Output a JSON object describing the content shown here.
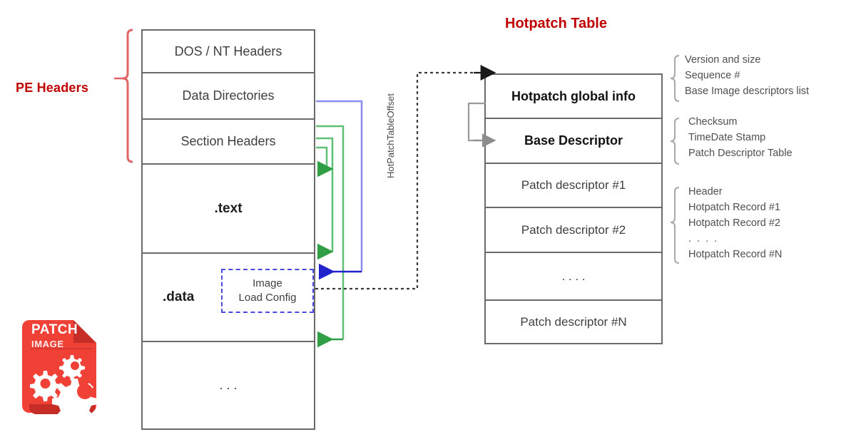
{
  "diagram": {
    "title_hotpatch_table": "Hotpatch Table",
    "pe_headers_label": "PE Headers",
    "offset_label": "HotPatchTableOffset",
    "colors": {
      "accent_red": "#c00000",
      "box_border": "#6a6a6a",
      "green_arrow": "#2f9e44",
      "blue_arrow": "#2222cc",
      "dashed_blue": "#4a4ae0",
      "gray_arrow": "#8c8c8c",
      "dotted_black": "#3a3a3a",
      "logo_red": "#ef4136"
    }
  },
  "pe_image": {
    "rows": [
      {
        "label": "DOS / NT Headers",
        "bold": false
      },
      {
        "label": "Data Directories",
        "bold": false
      },
      {
        "label": "Section Headers",
        "bold": false
      },
      {
        "label": ".text",
        "bold": true
      },
      {
        "label": ".data",
        "bold": true
      },
      {
        "label": ". . .",
        "bold": false
      }
    ],
    "image_load_config": {
      "line1": "Image",
      "line2": "Load Config"
    }
  },
  "hotpatch_table": {
    "rows": [
      {
        "label": "Hotpatch global info",
        "bold": true
      },
      {
        "label": "Base Descriptor",
        "bold": true
      },
      {
        "label": "Patch descriptor #1",
        "bold": false
      },
      {
        "label": "Patch descriptor #2",
        "bold": false
      },
      {
        "label": ". . . .",
        "bold": false
      },
      {
        "label": "Patch descriptor #N",
        "bold": false
      }
    ]
  },
  "annotations": [
    {
      "id": "global-info-fields",
      "items": [
        "Version and size",
        "Sequence #",
        "Base Image descriptors list"
      ]
    },
    {
      "id": "base-descriptor-fields",
      "items": [
        "Checksum",
        "TimeDate Stamp",
        "Patch Descriptor Table"
      ]
    },
    {
      "id": "patch-descriptor-fields",
      "items": [
        "Header",
        "Hotpatch Record #1",
        "Hotpatch Record #2",
        ". . . .",
        "Hotpatch Record #N"
      ]
    }
  ],
  "logo": {
    "title": "PATCH",
    "subtitle": "IMAGE"
  }
}
